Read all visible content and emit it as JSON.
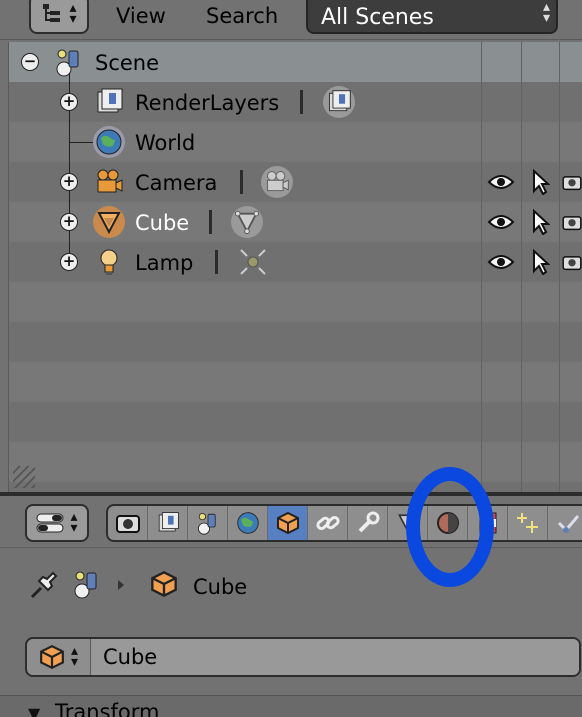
{
  "outliner": {
    "header": {
      "menu": {
        "view": "View",
        "search": "Search"
      },
      "scene_filter": "All Scenes"
    },
    "rows": [
      {
        "name": "Scene",
        "expander": "−",
        "icon": "scene-icon",
        "data_icon": null
      },
      {
        "name": "RenderLayers",
        "expander": "+",
        "icon": "render-layers-icon",
        "data_icon": "render-layers-data-icon"
      },
      {
        "name": "World",
        "expander": null,
        "icon": "world-icon",
        "data_icon": null
      },
      {
        "name": "Camera",
        "expander": "+",
        "icon": "camera-object-icon",
        "data_icon": "camera-data-icon"
      },
      {
        "name": "Cube",
        "expander": "+",
        "icon": "mesh-object-icon",
        "data_icon": "mesh-data-icon"
      },
      {
        "name": "Lamp",
        "expander": "+",
        "icon": "lamp-object-icon",
        "data_icon": "lamp-data-icon"
      }
    ]
  },
  "properties": {
    "context_tabs": [
      "render-icon",
      "render-layers-icon",
      "scene-icon",
      "world-icon",
      "object-icon",
      "constraints-icon",
      "modifiers-icon",
      "object-data-icon",
      "material-icon",
      "texture-icon",
      "particles-icon",
      "physics-icon"
    ],
    "active_tab": "object-icon",
    "breadcrumb_label": "Cube",
    "object_name": "Cube",
    "panel_title": "Transform"
  },
  "colors": {
    "active_tab": "#5680c2",
    "annotation": "#0a48e0",
    "selected_object": "#c98a4c"
  }
}
